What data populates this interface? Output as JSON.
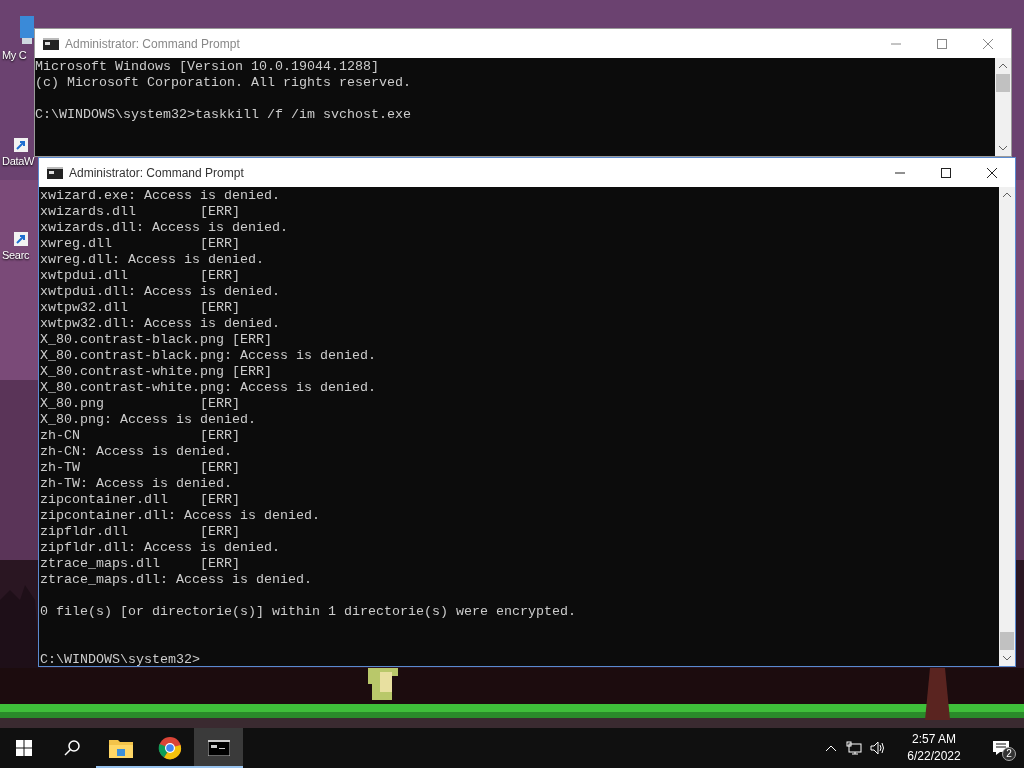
{
  "desktop_icons": [
    {
      "label": "My C",
      "kind": "computer"
    },
    {
      "label": "DataW",
      "kind": "shortcut"
    },
    {
      "label": "Searc",
      "kind": "shortcut"
    }
  ],
  "windows": [
    {
      "title": "Administrator: Command Prompt",
      "active": false,
      "blocks": [
        [
          "Microsoft Windows [Version 10.0.19044.1288]",
          "(c) Microsoft Corporation. All rights reserved."
        ],
        [
          "C:\\WINDOWS\\system32>taskkill /f /im svchost.exe"
        ]
      ]
    },
    {
      "title": "Administrator: Command Prompt",
      "active": true,
      "blocks": [
        [
          "xwizard.exe: Access is denied.",
          "xwizards.dll        [ERR]",
          "xwizards.dll: Access is denied.",
          "xwreg.dll           [ERR]",
          "xwreg.dll: Access is denied.",
          "xwtpdui.dll         [ERR]",
          "xwtpdui.dll: Access is denied.",
          "xwtpw32.dll         [ERR]",
          "xwtpw32.dll: Access is denied.",
          "X_80.contrast-black.png [ERR]",
          "X_80.contrast-black.png: Access is denied.",
          "X_80.contrast-white.png [ERR]",
          "X_80.contrast-white.png: Access is denied.",
          "X_80.png            [ERR]",
          "X_80.png: Access is denied.",
          "zh-CN               [ERR]",
          "zh-CN: Access is denied.",
          "zh-TW               [ERR]",
          "zh-TW: Access is denied.",
          "zipcontainer.dll    [ERR]",
          "zipcontainer.dll: Access is denied.",
          "zipfldr.dll         [ERR]",
          "zipfldr.dll: Access is denied.",
          "ztrace_maps.dll     [ERR]",
          "ztrace_maps.dll: Access is denied."
        ],
        [
          "0 file(s) [or directorie(s)] within 1 directorie(s) were encrypted."
        ]
      ],
      "prompt": "C:\\WINDOWS\\system32>"
    }
  ],
  "taskbar": {
    "apps": [
      {
        "kind": "explorer",
        "running": true,
        "selected": false
      },
      {
        "kind": "chrome",
        "running": true,
        "selected": false
      },
      {
        "kind": "cmd",
        "running": true,
        "selected": true
      }
    ],
    "time": "2:57 AM",
    "date": "6/22/2022",
    "notifications": "2"
  }
}
